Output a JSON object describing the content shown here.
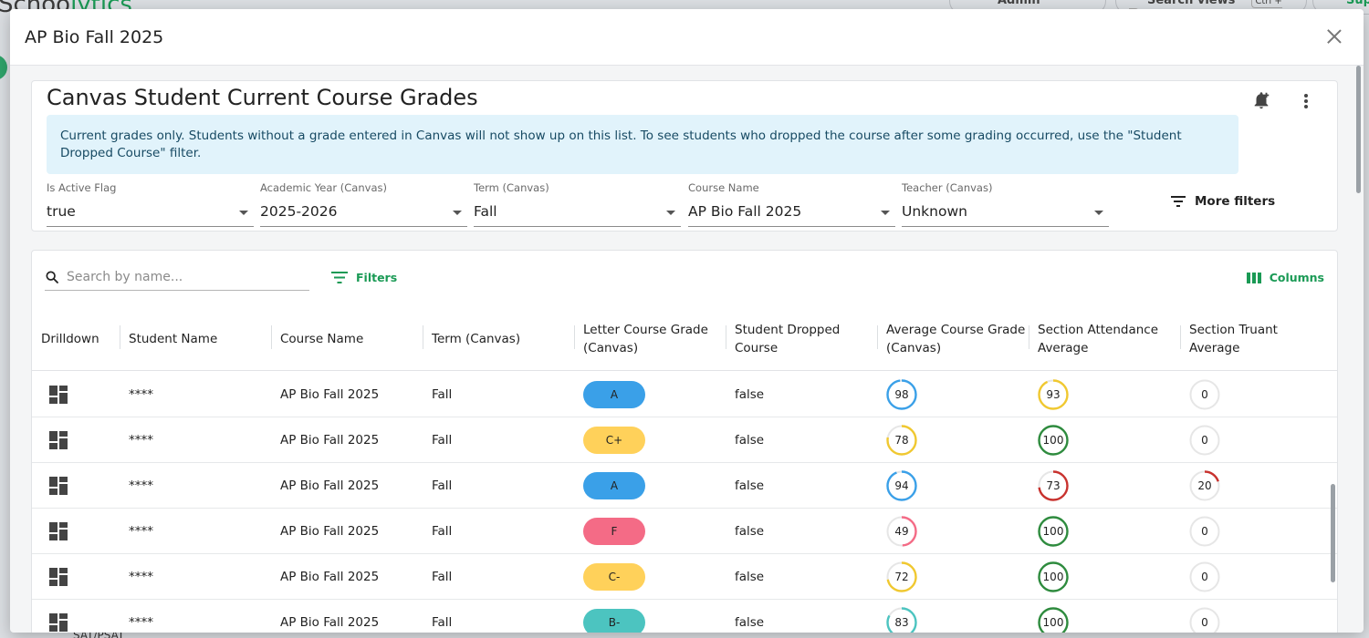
{
  "background": {
    "logo_start": "Schoo",
    "logo_accent": "lytics",
    "admin_label": "Admin",
    "search_views_label": "Search views",
    "shortcut_label": "Ctrl + K",
    "support_label": "Sup",
    "side_item": "SAT/PSAT"
  },
  "modal": {
    "title": "AP Bio Fall 2025"
  },
  "report": {
    "title": "Canvas Student Current Course Grades",
    "info": "Current grades only. Students without a grade entered in Canvas will not show up on this list. To see students who dropped the course after some grading occurred, use the \"Student Dropped Course\" filter.",
    "filters": [
      {
        "label": "Is Active Flag",
        "value": "true"
      },
      {
        "label": "Academic Year (Canvas)",
        "value": "2025-2026"
      },
      {
        "label": "Term (Canvas)",
        "value": "Fall"
      },
      {
        "label": "Course Name",
        "value": "AP Bio Fall 2025"
      },
      {
        "label": "Teacher (Canvas)",
        "value": "Unknown"
      }
    ],
    "more_filters_label": "More filters"
  },
  "table": {
    "search_placeholder": "Search by name...",
    "filters_label": "Filters",
    "columns_label": "Columns",
    "headers": [
      "Drilldown",
      "Student Name",
      "Course Name",
      "Term (Canvas)",
      "Letter Course Grade (Canvas)",
      "Student Dropped Course",
      "Average Course Grade (Canvas)",
      "Section Attendance Average",
      "Section Truant Average"
    ],
    "rows": [
      {
        "student": "****",
        "course": "AP Bio Fall 2025",
        "term": "Fall",
        "letter": "A",
        "dropped": "false",
        "avg_grade": "98",
        "attendance": "93",
        "truant": "0"
      },
      {
        "student": "****",
        "course": "AP Bio Fall 2025",
        "term": "Fall",
        "letter": "C+",
        "dropped": "false",
        "avg_grade": "78",
        "attendance": "100",
        "truant": "0"
      },
      {
        "student": "****",
        "course": "AP Bio Fall 2025",
        "term": "Fall",
        "letter": "A",
        "dropped": "false",
        "avg_grade": "94",
        "attendance": "73",
        "truant": "20"
      },
      {
        "student": "****",
        "course": "AP Bio Fall 2025",
        "term": "Fall",
        "letter": "F",
        "dropped": "false",
        "avg_grade": "49",
        "attendance": "100",
        "truant": "0"
      },
      {
        "student": "****",
        "course": "AP Bio Fall 2025",
        "term": "Fall",
        "letter": "C-",
        "dropped": "false",
        "avg_grade": "72",
        "attendance": "100",
        "truant": "0"
      },
      {
        "student": "****",
        "course": "AP Bio Fall 2025",
        "term": "Fall",
        "letter": "B-",
        "dropped": "false",
        "avg_grade": "83",
        "attendance": "100",
        "truant": "0"
      }
    ]
  },
  "colors": {
    "brand_green": "#1a9a55",
    "grade_a": "#3aa0e8",
    "grade_b": "#4cc4c0",
    "grade_c": "#ffd15a",
    "grade_f": "#f46b86",
    "ring_good": "#2e8b3e",
    "ring_warn": "#f0c830",
    "ring_bad": "#c8322e",
    "ring_blue": "#3aa0e8",
    "ring_track": "#e6e6e6"
  },
  "icons": {
    "close": "close-icon",
    "bell": "bell-plus-icon",
    "kebab": "more-vert-icon",
    "search": "search-icon",
    "filter": "filter-lines-icon",
    "columns": "columns-icon",
    "drilldown": "dashboard-grid-icon"
  }
}
